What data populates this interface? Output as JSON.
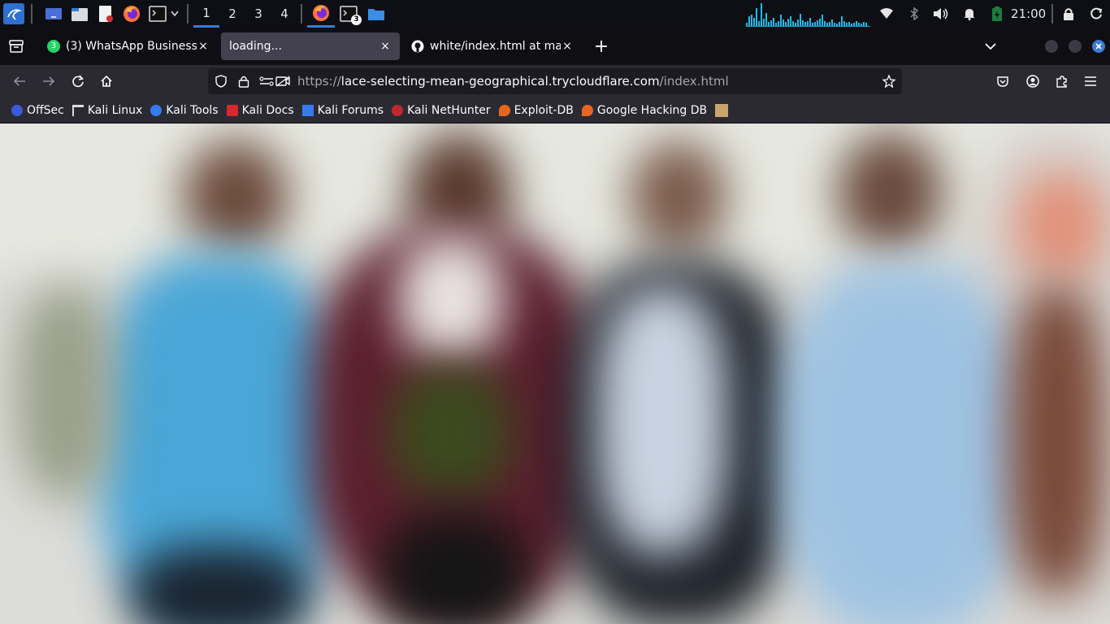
{
  "panel": {
    "workspaces": [
      "1",
      "2",
      "3",
      "4"
    ],
    "terminal_badge": "3",
    "clock": "21:00"
  },
  "tabs": [
    {
      "label": "(3) WhatsApp Business",
      "badge": "3",
      "close": "×"
    },
    {
      "label": "loading...",
      "close": "×"
    },
    {
      "label": "white/index.html at main",
      "close": "×"
    }
  ],
  "tabbar": {
    "new_tab": "+",
    "list_all": "⌄"
  },
  "urlbar": {
    "scheme": "https://",
    "host": "lace-selecting-mean-geographical.trycloudflare.com",
    "path": "/index.html"
  },
  "bookmarks": [
    {
      "label": "OffSec",
      "icon": "offsec-icon"
    },
    {
      "label": "Kali Linux",
      "icon": "kali-dragon-icon"
    },
    {
      "label": "Kali Tools",
      "icon": "kali-tools-icon"
    },
    {
      "label": "Kali Docs",
      "icon": "kali-docs-icon"
    },
    {
      "label": "Kali Forums",
      "icon": "kali-forums-icon"
    },
    {
      "label": "Kali NetHunter",
      "icon": "nethunter-icon"
    },
    {
      "label": "Exploit-DB",
      "icon": "exploitdb-icon"
    },
    {
      "label": "Google Hacking DB",
      "icon": "ghdb-icon"
    }
  ],
  "colors": {
    "panel_bg": "#0d0f15",
    "accent": "#3a7bd5",
    "tab_selected": "#42414d",
    "toolbar": "#2b2a33",
    "whatsapp_green": "#25d366"
  }
}
